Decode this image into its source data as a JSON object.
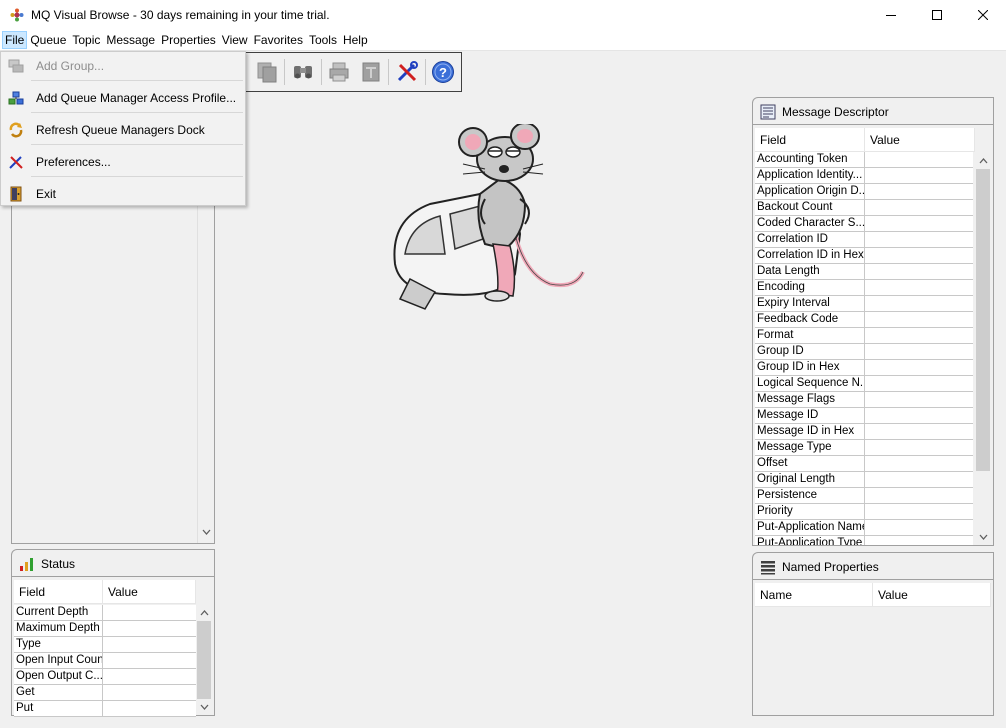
{
  "window": {
    "title": "MQ Visual Browse - 30 days remaining in your time trial."
  },
  "menubar": {
    "items": [
      "File",
      "Queue",
      "Topic",
      "Message",
      "Properties",
      "View",
      "Favorites",
      "Tools",
      "Help"
    ],
    "active": "File"
  },
  "file_menu": {
    "items": [
      {
        "label": "Add Group...",
        "icon": "group-icon",
        "enabled": false
      },
      {
        "label": "Add Queue Manager Access Profile...",
        "icon": "queue-manager-icon",
        "enabled": true
      },
      {
        "label": "Refresh Queue Managers Dock",
        "icon": "refresh-icon",
        "enabled": true
      },
      {
        "label": "Preferences...",
        "icon": "tools-icon",
        "enabled": true
      },
      {
        "label": "Exit",
        "icon": "exit-door-icon",
        "enabled": true
      }
    ]
  },
  "status_panel": {
    "title": "Status",
    "headers": [
      "Field",
      "Value"
    ],
    "rows": [
      "Current Depth",
      "Maximum Depth",
      "Type",
      "Open Input Count",
      "Open Output C...",
      "Get",
      "Put"
    ]
  },
  "message_descriptor": {
    "title": "Message Descriptor",
    "headers": [
      "Field",
      "Value"
    ],
    "rows": [
      "Accounting Token",
      "Application Identity...",
      "Application Origin D...",
      "Backout Count",
      "Coded Character S...",
      "Correlation ID",
      "Correlation ID in Hex",
      "Data Length",
      "Encoding",
      "Expiry Interval",
      "Feedback Code",
      "Format",
      "Group ID",
      "Group ID in Hex",
      "Logical Sequence N...",
      "Message Flags",
      "Message ID",
      "Message ID in Hex",
      "Message Type",
      "Offset",
      "Original Length",
      "Persistence",
      "Priority",
      "Put-Application Name",
      "Put-Application Type"
    ]
  },
  "named_properties": {
    "title": "Named Properties",
    "headers": [
      "Name",
      "Value"
    ]
  },
  "colors": {
    "menu_highlight": "#cce8ff",
    "help_blue": "#3b6fd8",
    "mascot_pink": "#f0a8b8"
  }
}
